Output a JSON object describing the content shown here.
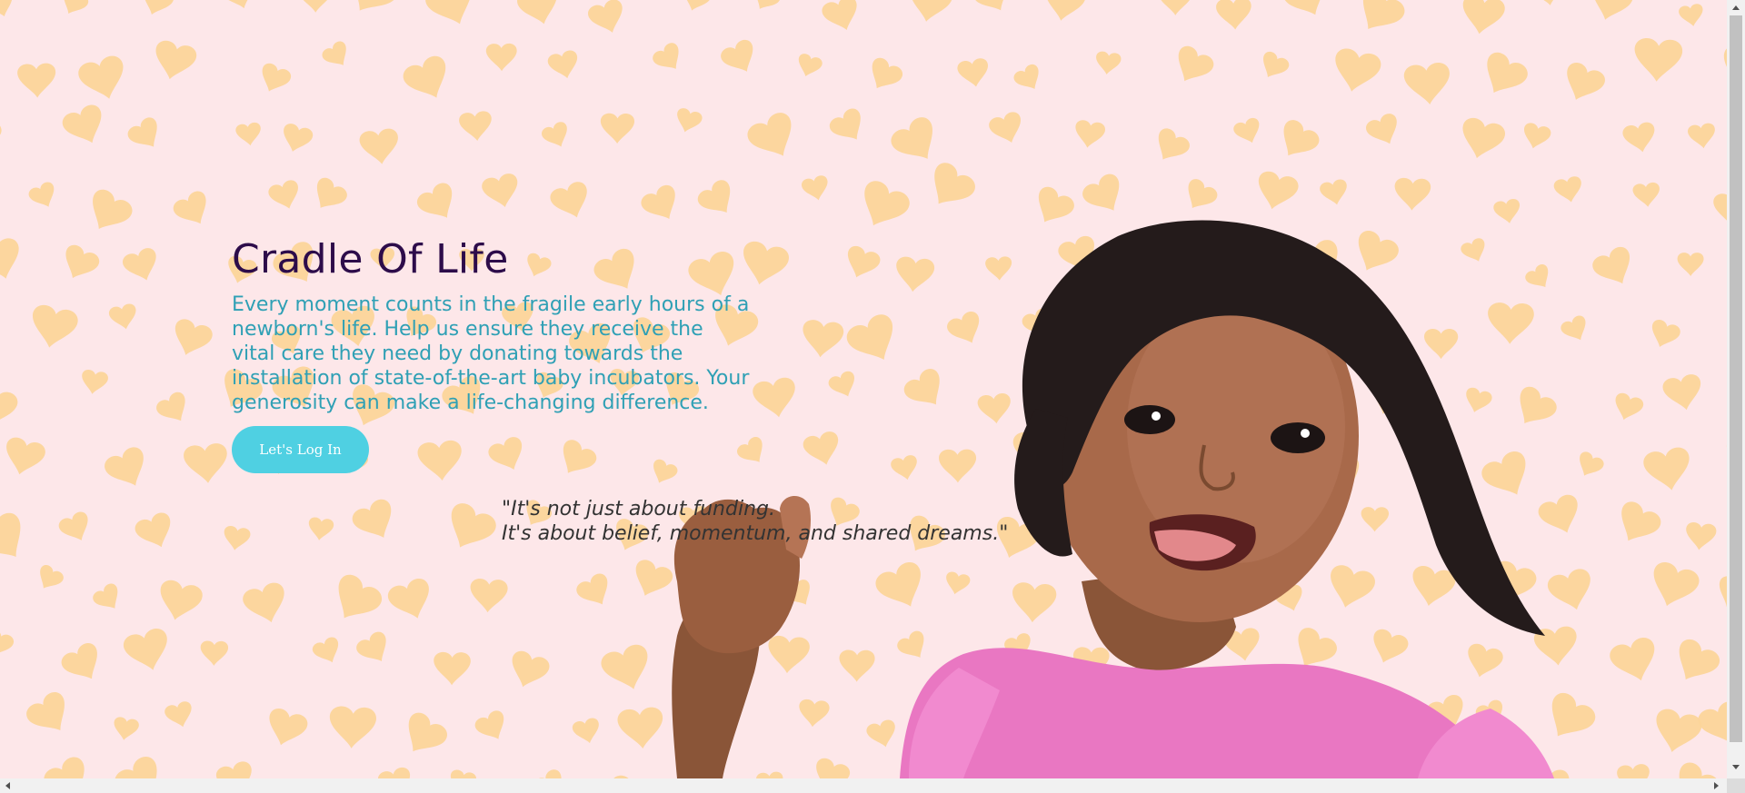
{
  "hero": {
    "title": "Cradle Of Life",
    "description": "Every moment counts in the fragile early hours of a newborn's life. Help us ensure they receive the vital care they need by donating towards the installation of state-of-the-art baby incubators. Your generosity can make a life-changing difference.",
    "login_button": "Let's Log In"
  },
  "quote": {
    "line1": "\"It's not just about funding.",
    "line2": "It's about belief, momentum, and shared dreams.\""
  },
  "colors": {
    "background": "#fde7e9",
    "hearts": "#fcd59a",
    "title": "#2d0c4a",
    "description": "#2fa0b5",
    "button": "#4fd0e2"
  }
}
